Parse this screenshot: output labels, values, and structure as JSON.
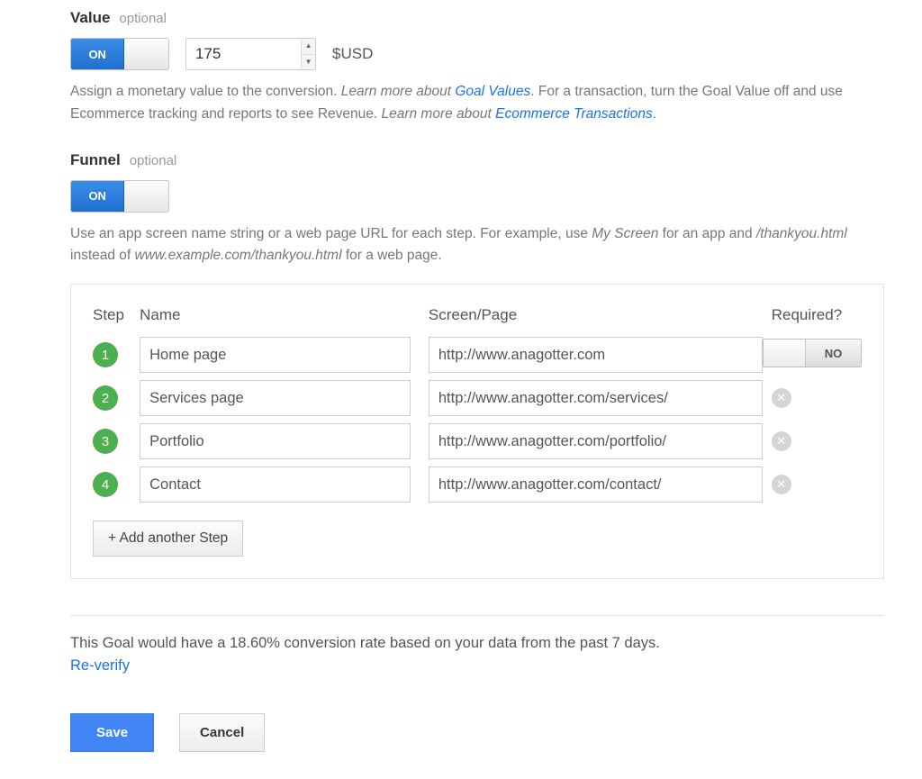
{
  "value": {
    "title": "Value",
    "optional": "optional",
    "toggle_on": "ON",
    "amount": "175",
    "currency": "$USD",
    "desc1_a": "Assign a monetary value to the conversion. ",
    "desc1_b_italic": "Learn more about ",
    "desc1_link1": "Goal Values",
    "desc1_c": ". For a transaction, turn the Goal Value off and use Ecommerce tracking and reports to see Revenue. ",
    "desc1_d_italic": "Learn more about ",
    "desc1_link2": "Ecommerce Transactions",
    "desc1_e": "."
  },
  "funnel": {
    "title": "Funnel",
    "optional": "optional",
    "toggle_on": "ON",
    "desc_a": "Use an app screen name string or a web page URL for each step. For example, use ",
    "desc_b_italic": "My Screen",
    "desc_c": " for an app and ",
    "desc_d_italic": "/thankyou.html",
    "desc_e": " instead of ",
    "desc_f_italic": "www.example.com/thankyou.html",
    "desc_g": " for a web page.",
    "headers": {
      "step": "Step",
      "name": "Name",
      "page": "Screen/Page",
      "required": "Required?"
    },
    "required_toggle_label": "NO",
    "steps": [
      {
        "n": "1",
        "name": "Home page",
        "page": "http://www.anagotter.com"
      },
      {
        "n": "2",
        "name": "Services page",
        "page": "http://www.anagotter.com/services/"
      },
      {
        "n": "3",
        "name": "Portfolio",
        "page": "http://www.anagotter.com/portfolio/"
      },
      {
        "n": "4",
        "name": "Contact",
        "page": "http://www.anagotter.com/contact/"
      }
    ],
    "add_step": "+ Add another Step"
  },
  "verify": {
    "text": "This Goal would have a 18.60% conversion rate based on your data from the past 7 days.",
    "reverify": "Re-verify"
  },
  "buttons": {
    "save": "Save",
    "cancel": "Cancel"
  }
}
